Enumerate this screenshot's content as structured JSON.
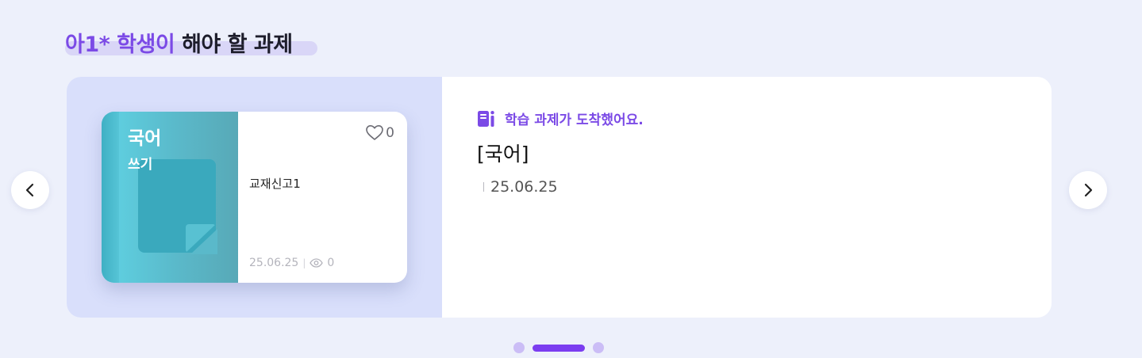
{
  "section": {
    "title_accent": "아1* 학생이",
    "title_rest": " 해야 할 과제"
  },
  "book": {
    "subject": "국어",
    "type": "쓰기",
    "name": "교재신고1",
    "like_count": "0",
    "date": "25.06.25",
    "view_count": "0"
  },
  "detail": {
    "notice": "학습 과제가 도착했어요.",
    "title": "[국어]",
    "date": "25.06.25"
  },
  "icons": {
    "prev": "chevron-left-icon",
    "next": "chevron-right-icon",
    "like": "heart-outline-icon",
    "views": "eye-icon",
    "notice": "book-icon"
  },
  "colors": {
    "accent": "#7b4ae6",
    "active_dot": "#7b3df0",
    "inactive_dot": "#cbbdf6",
    "panel": "#d9dffb",
    "cover": "#5ab9ca"
  },
  "pagination": {
    "total": 3,
    "active_index": 1
  }
}
